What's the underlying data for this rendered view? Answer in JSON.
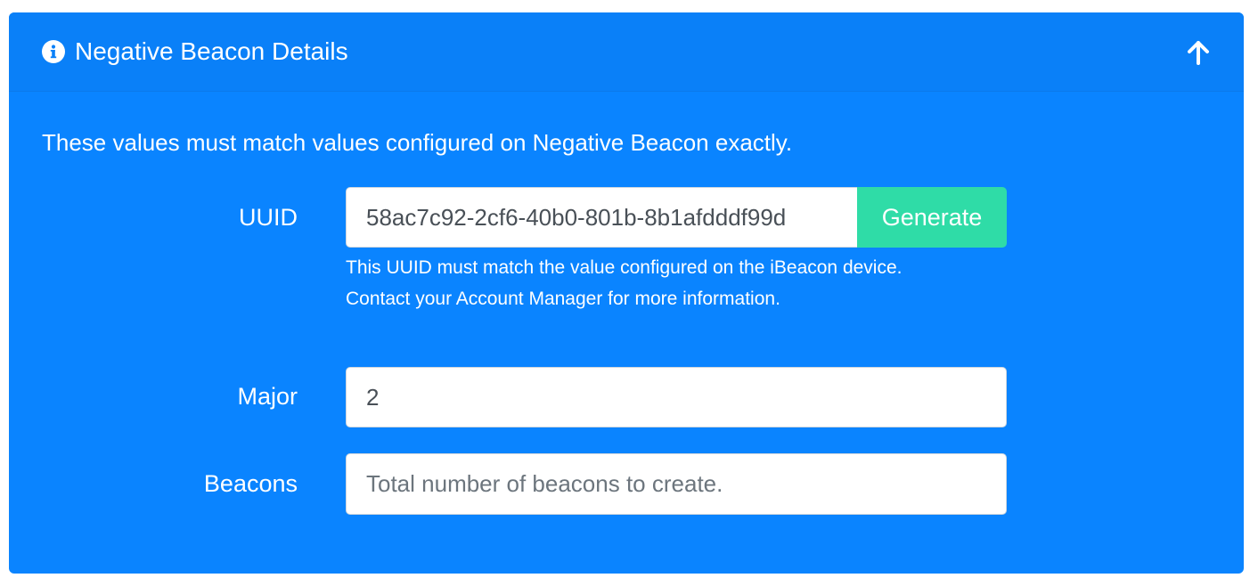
{
  "header": {
    "title": "Negative Beacon Details",
    "info_icon": "info-circle-icon",
    "collapse_icon": "arrow-up-icon"
  },
  "intro_text": "These values must match values configured on Negative Beacon exactly.",
  "uuid": {
    "label": "UUID",
    "value": "58ac7c92-2cf6-40b0-801b-8b1afdddf99d",
    "generate_label": "Generate",
    "help_line_1": "This UUID must match the value configured on the iBeacon device.",
    "help_line_2": "Contact your Account Manager for more information."
  },
  "major": {
    "label": "Major",
    "value": "2"
  },
  "beacons": {
    "label": "Beacons",
    "value": "",
    "placeholder": "Total number of beacons to create."
  },
  "colors": {
    "panel": "#0a84ff",
    "generate_button": "#2fdca7",
    "text": "#ffffff"
  }
}
